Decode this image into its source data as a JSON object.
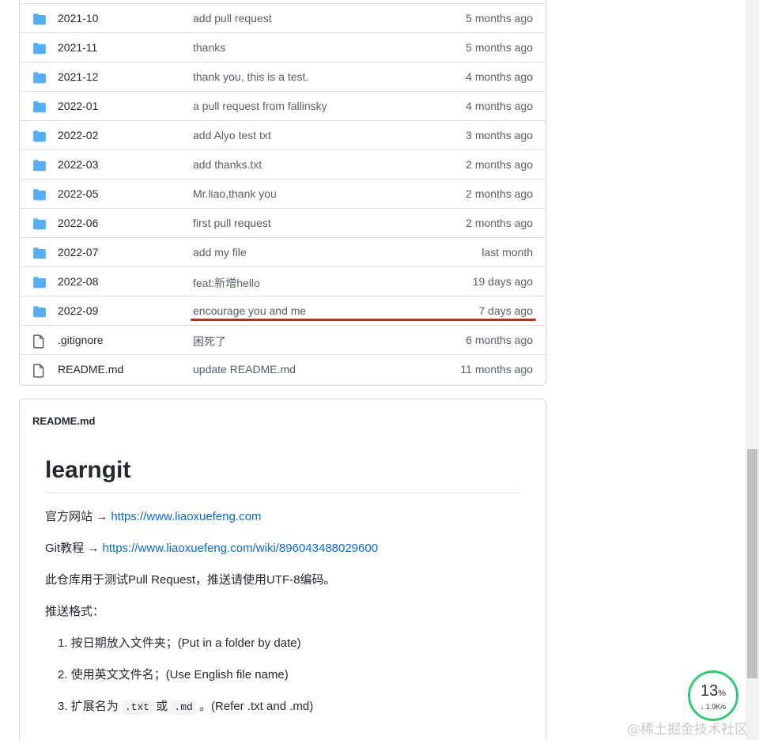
{
  "files": [
    {
      "type": "folder",
      "name": "2021-10",
      "message": "add pull request",
      "age": "5 months ago"
    },
    {
      "type": "folder",
      "name": "2021-11",
      "message": "thanks",
      "age": "5 months ago"
    },
    {
      "type": "folder",
      "name": "2021-12",
      "message": "thank you, this is a test.",
      "age": "4 months ago"
    },
    {
      "type": "folder",
      "name": "2022-01",
      "message": "a pull request from fallinsky",
      "age": "4 months ago"
    },
    {
      "type": "folder",
      "name": "2022-02",
      "message": "add Alyo test txt",
      "age": "3 months ago"
    },
    {
      "type": "folder",
      "name": "2022-03",
      "message": "add thanks.txt",
      "age": "2 months ago"
    },
    {
      "type": "folder",
      "name": "2022-05",
      "message": "Mr.liao,thank you",
      "age": "2 months ago"
    },
    {
      "type": "folder",
      "name": "2022-06",
      "message": "first pull request",
      "age": "2 months ago"
    },
    {
      "type": "folder",
      "name": "2022-07",
      "message": "add my file",
      "age": "last month"
    },
    {
      "type": "folder",
      "name": "2022-08",
      "message": "feat:新增hello",
      "age": "19 days ago"
    },
    {
      "type": "folder",
      "name": "2022-09",
      "message": "encourage you and me",
      "age": "7 days ago"
    },
    {
      "type": "file",
      "name": ".gitignore",
      "message": "困死了",
      "age": "6 months ago"
    },
    {
      "type": "file",
      "name": "README.md",
      "message": "update README.md",
      "age": "11 months ago"
    }
  ],
  "readme": {
    "filename": "README.md",
    "heading": "learngit",
    "site_prefix": "官方网站 → ",
    "site_link": "https://www.liaoxuefeng.com",
    "tutorial_prefix": "Git教程 → ",
    "tutorial_link": "https://www.liaoxuefeng.com/wiki/896043488029600",
    "purpose": "此仓库用于测试Pull Request，推送请使用UTF-8编码。",
    "format_label": "推送格式：",
    "items": [
      {
        "num": "1.",
        "text": "按日期放入文件夹；(Put in a folder by date)"
      },
      {
        "num": "2.",
        "text": "使用英文文件名；(Use English file name)"
      },
      {
        "num": "3.",
        "pre": "扩展名为 ",
        "code1": ".txt",
        "mid": " 或 ",
        "code2": ".md",
        "post": " 。(Refer .txt and .md)"
      }
    ]
  },
  "speed_widget": {
    "percent": "13",
    "unit": "%",
    "rate": "↓ 1.9K/s"
  },
  "watermark": "@稀土掘金技术社区",
  "colors": {
    "folder": "#54aeff",
    "link": "#0969da",
    "highlight_underline": "#d61f1f",
    "ring": "#2fcc71"
  }
}
